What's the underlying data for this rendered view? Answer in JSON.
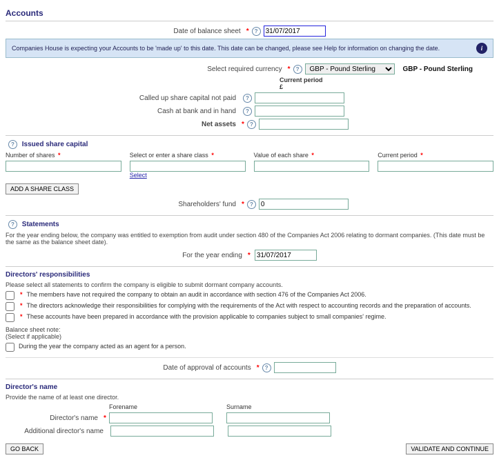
{
  "header": {
    "title": "Accounts"
  },
  "balance": {
    "date_label": "Date of balance sheet",
    "date_value": "31/07/2017"
  },
  "info_bar": {
    "text": "Companies House is expecting your Accounts to be 'made up' to this date. This date can be changed, please see Help for information on changing the date."
  },
  "currency": {
    "select_label": "Select required currency",
    "selected": "GBP - Pound Sterling",
    "display": "GBP - Pound Sterling",
    "period_label": "Current period",
    "period_symbol": "£"
  },
  "fields": {
    "called_up": "Called up share capital not paid",
    "cash": "Cash at bank and in hand",
    "net_assets": "Net assets"
  },
  "share_capital": {
    "title": "Issued share capital",
    "num_shares": "Number of shares",
    "share_class": "Select or enter a share class",
    "value_each": "Value of each share",
    "current_period": "Current period",
    "select_link": "Select",
    "add_btn": "ADD A SHARE CLASS",
    "shareholders_fund": "Shareholders' fund",
    "shareholders_value": "0"
  },
  "statements": {
    "title": "Statements",
    "intro": "For the year ending below, the company was entitled to exemption from audit under section 480 of the Companies Act 2006 relating to dormant companies. (This date must be the same as the balance sheet date).",
    "year_ending_label": "For the year ending",
    "year_ending_value": "31/07/2017"
  },
  "responsibilities": {
    "title": "Directors' responsibilities",
    "intro": "Please select all statements to confirm the company is eligible to submit dormant company accounts.",
    "s1": "The members have not required the company to obtain an audit in accordance with section 476 of the Companies Act 2006.",
    "s2": "The directors acknowledge their responsibilities for complying with the requirements of the Act with respect to accounting records and the preparation of accounts.",
    "s3": "These accounts have been prepared in accordance with the provision applicable to companies subject to small companies' regime.",
    "note_label": "Balance sheet note:",
    "note_sub": "(Select if applicable)",
    "agent": "During the year the company acted as an agent for a person.",
    "approval_label": "Date of approval of accounts"
  },
  "director": {
    "title": "Director's name",
    "intro": "Provide the name of at least one director.",
    "forename": "Forename",
    "surname": "Surname",
    "name_label": "Director's name",
    "additional_label": "Additional director's name"
  },
  "footer": {
    "back": "GO BACK",
    "validate": "VALIDATE AND CONTINUE"
  }
}
